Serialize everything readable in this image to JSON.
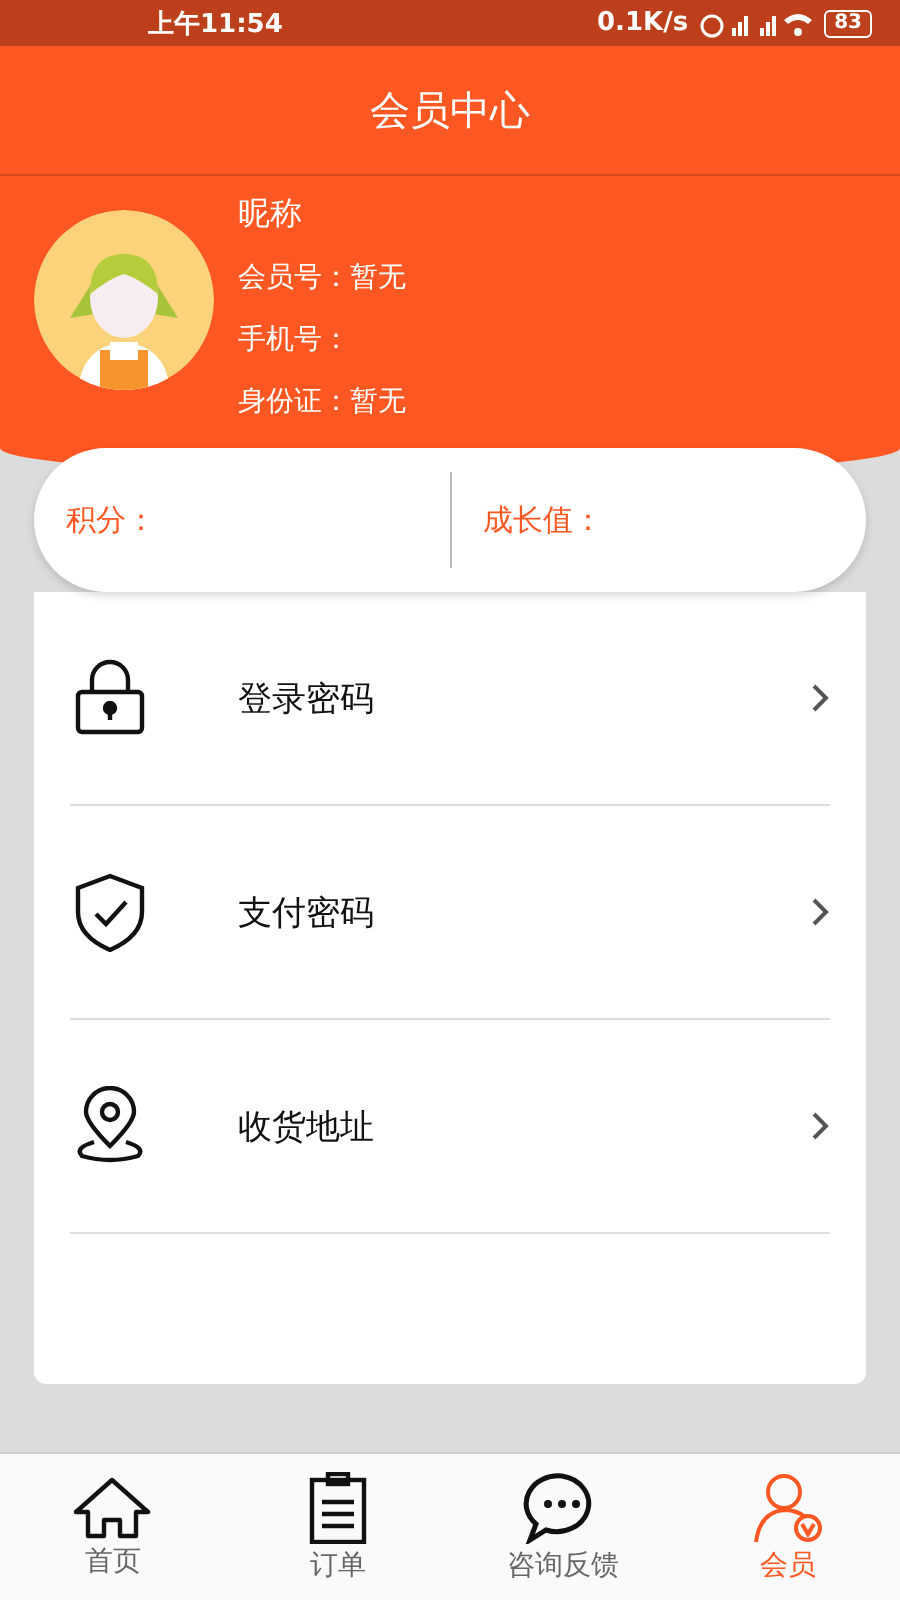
{
  "status_bar": {
    "time": "上午11:54",
    "speed": "0.1K/s",
    "battery": "83"
  },
  "header": {
    "title": "会员中心"
  },
  "profile": {
    "nickname": "昵称",
    "fields": [
      {
        "label": "会员号：",
        "value": "暂无"
      },
      {
        "label": "手机号："
      },
      {
        "label": "身份证：",
        "value": "暂无"
      }
    ]
  },
  "points": [
    {
      "label": "积分："
    },
    {
      "label": "成长值："
    }
  ],
  "menu": [
    {
      "label": "登录密码"
    },
    {
      "label": "支付密码"
    },
    {
      "label": "收货地址"
    }
  ],
  "tabs": [
    {
      "label": "首页",
      "selected": false
    },
    {
      "label": "订单",
      "selected": false
    },
    {
      "label": "咨询反馈",
      "selected": false
    },
    {
      "label": "会员",
      "selected": true
    }
  ]
}
